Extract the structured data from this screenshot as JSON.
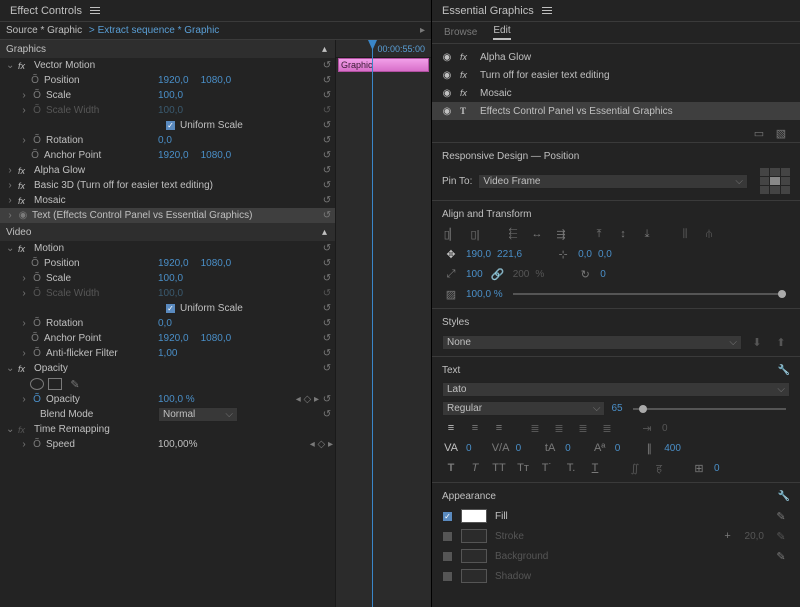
{
  "left_panel": {
    "title": "Effect Controls",
    "source_label": "Source * Graphic",
    "sequence_label": "Extract sequence * Graphic",
    "timecode": "00:00:55:00",
    "clip_label": "Graphic",
    "sections": {
      "graphics": "Graphics",
      "video": "Video"
    },
    "fx": {
      "vector_motion": {
        "name": "Vector Motion",
        "position": {
          "label": "Position",
          "x": "1920,0",
          "y": "1080,0"
        },
        "scale": {
          "label": "Scale",
          "val": "100,0"
        },
        "scale_width": {
          "label": "Scale Width",
          "val": "100,0"
        },
        "uniform": {
          "label": "Uniform Scale"
        },
        "rotation": {
          "label": "Rotation",
          "val": "0,0"
        },
        "anchor": {
          "label": "Anchor Point",
          "x": "1920,0",
          "y": "1080,0"
        }
      },
      "alpha_glow": "Alpha Glow",
      "basic3d": "Basic 3D (Turn off for easier text editing)",
      "mosaic": "Mosaic",
      "text_layer": "Text (Effects Control Panel vs Essential Graphics)",
      "motion": {
        "name": "Motion",
        "position": {
          "label": "Position",
          "x": "1920,0",
          "y": "1080,0"
        },
        "scale": {
          "label": "Scale",
          "val": "100,0"
        },
        "scale_width": {
          "label": "Scale Width",
          "val": "100,0"
        },
        "uniform": {
          "label": "Uniform Scale"
        },
        "rotation": {
          "label": "Rotation",
          "val": "0,0"
        },
        "anchor": {
          "label": "Anchor Point",
          "x": "1920,0",
          "y": "1080,0"
        },
        "antiflicker": {
          "label": "Anti-flicker Filter",
          "val": "1,00"
        }
      },
      "opacity": {
        "name": "Opacity",
        "label": "Opacity",
        "val": "100,0 %",
        "blend_label": "Blend Mode",
        "blend_val": "Normal"
      },
      "time": {
        "name": "Time Remapping",
        "speed_label": "Speed",
        "speed_val": "100,00%"
      }
    }
  },
  "right_panel": {
    "title": "Essential Graphics",
    "tabs": {
      "browse": "Browse",
      "edit": "Edit"
    },
    "layers": [
      {
        "type": "fx",
        "name": "Alpha Glow"
      },
      {
        "type": "fx",
        "name": "Turn off for easier text editing"
      },
      {
        "type": "fx",
        "name": "Mosaic"
      },
      {
        "type": "T",
        "name": "Effects Control Panel vs Essential Graphics"
      }
    ],
    "responsive": {
      "title": "Responsive Design — Position",
      "pin_label": "Pin To:",
      "pin_val": "Video Frame"
    },
    "align": {
      "title": "Align and Transform",
      "pos_x": "190,0",
      "pos_y": "221,6",
      "anch_x": "0,0",
      "anch_y": "0,0",
      "scale": "100",
      "scale2": "200",
      "pct": "%",
      "rot": "0",
      "opacity": "100,0 %"
    },
    "styles": {
      "title": "Styles",
      "val": "None"
    },
    "text": {
      "title": "Text",
      "font": "Lato",
      "weight": "Regular",
      "size": "65",
      "tracking": "0",
      "va": "0",
      "leading": "0",
      "baseline": "0",
      "tsume": "0",
      "faux": "400"
    },
    "appearance": {
      "title": "Appearance",
      "fill": {
        "label": "Fill",
        "on": true,
        "color": "#ffffff"
      },
      "stroke": {
        "label": "Stroke",
        "on": false,
        "color": "#2b2b2b",
        "width": "20,0"
      },
      "background": {
        "label": "Background",
        "on": false,
        "color": "#2b2b2b"
      },
      "shadow": {
        "label": "Shadow",
        "on": false,
        "color": "#2b2b2b"
      }
    }
  }
}
